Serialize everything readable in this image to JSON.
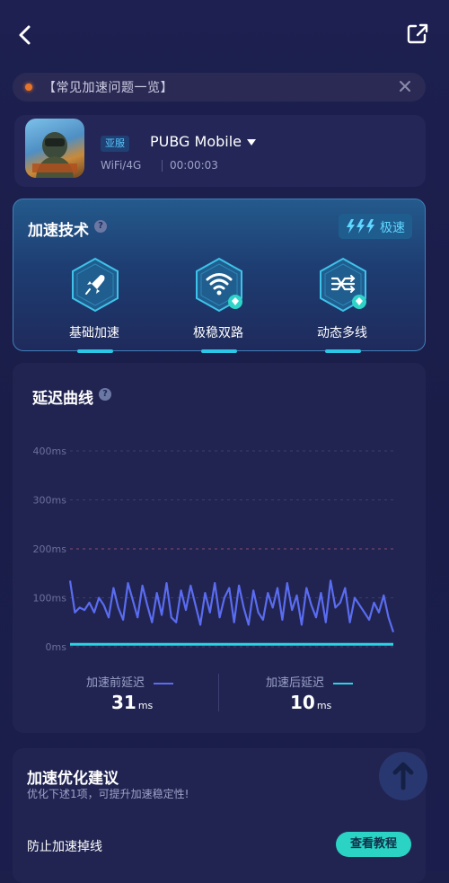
{
  "header": {
    "back_icon": "chevron-left-icon",
    "share_icon": "share-external-icon"
  },
  "notice": {
    "text": "【常见加速问题一览】",
    "dot_color": "#e8742a",
    "close_icon": "close-icon"
  },
  "game": {
    "region_badge": "亚服",
    "name": "PUBG Mobile",
    "network": "WiFi/4G",
    "elapsed": "00:00:03",
    "dropdown_icon": "caret-down-icon",
    "thumbnail_icon": "game-thumbnail"
  },
  "tech": {
    "title": "加速技术",
    "help_icon": "question-icon",
    "mode_icon": "triple-bolt-icon",
    "mode_label": "极速",
    "features": [
      {
        "label": "基础加速",
        "icon": "rocket-icon"
      },
      {
        "label": "极稳双路",
        "icon": "wifi-icon"
      },
      {
        "label": "动态多线",
        "icon": "multiline-icon"
      }
    ]
  },
  "delay": {
    "title": "延迟曲线",
    "help_icon": "question-icon",
    "before_label": "加速前延迟",
    "before_value": "31",
    "after_label": "加速后延迟",
    "after_value": "10",
    "unit": "ms"
  },
  "chart_data": {
    "type": "line",
    "title": "延迟曲线",
    "xlabel": "",
    "ylabel": "",
    "ylim": [
      0,
      400
    ],
    "y_ticks": [
      "400ms",
      "300ms",
      "200ms",
      "100ms",
      "0ms"
    ],
    "y_tick_values": [
      400,
      300,
      200,
      100,
      0
    ],
    "grid": true,
    "threshold_line": 200,
    "series": [
      {
        "name": "加速前延迟",
        "color": "#5a6cf0",
        "values": [
          135,
          70,
          80,
          75,
          90,
          70,
          100,
          85,
          60,
          120,
          80,
          55,
          130,
          95,
          60,
          125,
          85,
          50,
          110,
          65,
          130,
          60,
          50,
          115,
          75,
          125,
          85,
          45,
          110,
          70,
          130,
          60,
          100,
          120,
          50,
          125,
          80,
          45,
          115,
          70,
          55,
          110,
          80,
          120,
          55,
          130,
          75,
          105,
          45,
          120,
          85,
          60,
          110,
          50,
          135,
          80,
          90,
          120,
          50,
          100,
          85,
          70,
          55,
          90,
          70,
          105,
          60,
          30
        ]
      },
      {
        "name": "加速后延迟",
        "color": "#2bd3e6",
        "values": [
          5,
          5,
          5,
          5,
          5,
          5,
          5,
          5,
          5,
          5,
          5,
          5,
          5,
          5,
          5,
          5,
          5,
          5,
          5,
          5,
          5,
          5,
          5,
          5,
          5,
          5,
          5,
          5,
          5,
          5,
          5,
          5,
          5,
          5,
          5,
          5,
          5,
          5,
          5,
          5,
          5,
          5,
          5,
          5,
          5,
          5,
          5,
          5,
          5,
          5,
          5,
          5,
          5,
          5,
          5,
          5,
          5,
          5,
          5,
          5,
          5,
          5,
          5,
          5,
          5,
          5,
          5,
          5
        ]
      }
    ]
  },
  "advice": {
    "title": "加速优化建议",
    "subtitle": "优化下述1项，可提升加速稳定性!",
    "item": "防止加速掉线",
    "button": "查看教程",
    "scroll_icon": "arrow-up-icon"
  }
}
